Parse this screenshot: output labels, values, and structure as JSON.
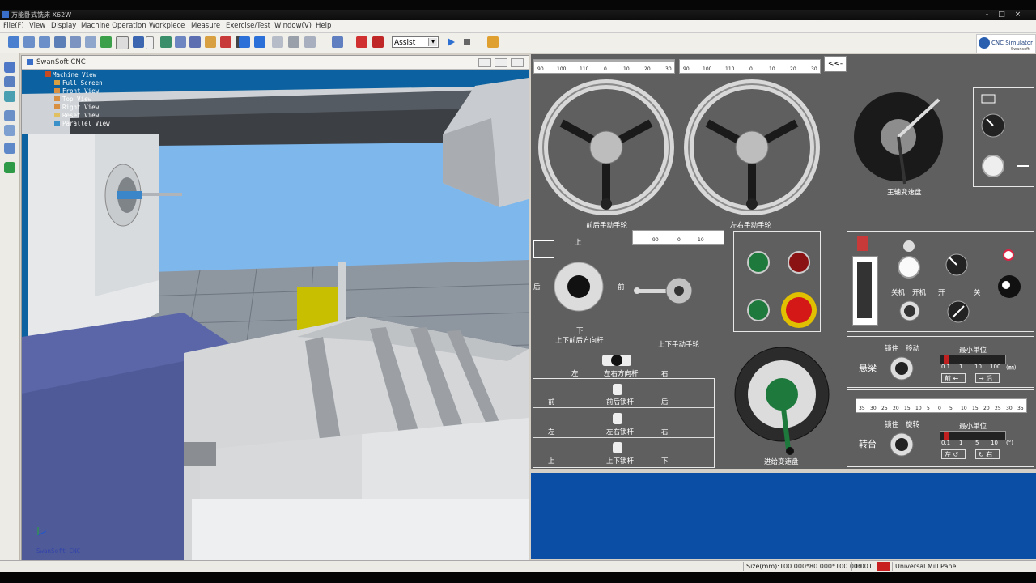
{
  "window": {
    "title": "万能卧式铣床 X62W",
    "controls": [
      "-",
      "□",
      "×"
    ]
  },
  "menubar": {
    "items": [
      "File(F)",
      "View",
      "Display",
      "Machine Operation",
      "Workpiece",
      "Measure",
      "Exercise/Test",
      "Window(V)",
      "Help"
    ]
  },
  "toolbar": {
    "mode_select": "Assist",
    "logo_text": "CNC Simulator",
    "logo_sub": "Swansoft"
  },
  "viewport": {
    "title": "SwanSoft CNC",
    "tree_root": "Machine View",
    "tree_items": [
      "Full Screen",
      "Front View",
      "Top View",
      "Right View",
      "Reset View",
      "Parallel View"
    ],
    "watermark": "SwanSoft CNC"
  },
  "panel": {
    "collapse_button": "<<-",
    "scale_top_ticks": [
      "90",
      "100",
      "110",
      "0",
      "10",
      "20",
      "30"
    ],
    "scale_mid_ticks": [
      "90",
      "0",
      "10"
    ],
    "handwheel_front_back": "前后手动手轮",
    "handwheel_left_right": "左右手动手轮",
    "spindle_speed_dial": "主轴变速盘",
    "lever_up": "上",
    "lever_down": "下",
    "lever_back": "后",
    "lever_front": "前",
    "lever_updown_frontback": "上下前后方向杆",
    "handwheel_updown": "上下手动手轮",
    "lever_left": "左",
    "lever_right": "右",
    "lever_leftright": "左右方向杆",
    "lock_rows": [
      {
        "left": "前",
        "name": "前后锁杆",
        "right": "后"
      },
      {
        "left": "左",
        "name": "左右锁杆",
        "right": "右"
      },
      {
        "left": "上",
        "name": "上下锁杆",
        "right": "下"
      }
    ],
    "feed_speed_dial": "进给变速盘",
    "power_off": "关机",
    "power_on": "开机",
    "light_on": "开",
    "light_off": "关",
    "beam_label": "悬梁",
    "beam_lock": "锁住",
    "beam_move": "移动",
    "min_unit": "最小单位",
    "beam_units": [
      "0.1",
      "1",
      "10",
      "100",
      "(㎜)"
    ],
    "beam_front": "前",
    "beam_back": "后",
    "rot_scale_ticks": [
      "35",
      "30",
      "25",
      "20",
      "15",
      "10",
      "5",
      "0",
      "5",
      "10",
      "15",
      "20",
      "25",
      "30",
      "35"
    ],
    "turntable_label": "转台",
    "turntable_lock": "锁住",
    "turntable_rotate": "旋转",
    "turntable_units": [
      "0.1",
      "1",
      "5",
      "10",
      "(°)"
    ],
    "turntable_left": "左",
    "turntable_right": "右"
  },
  "statusbar": {
    "size": "Size(mm):100.000*80.000*100.000",
    "tool": "T:001",
    "panel": "Universal Mill Panel"
  },
  "colors": {
    "panel_bg": "#5f5f5f",
    "green_button": "#1e7a3c",
    "red_button": "#8b1212",
    "estop": "#d41818",
    "workpiece": "#c8bf00",
    "sky": "#78b4ea",
    "table": "#cfcfcf"
  }
}
